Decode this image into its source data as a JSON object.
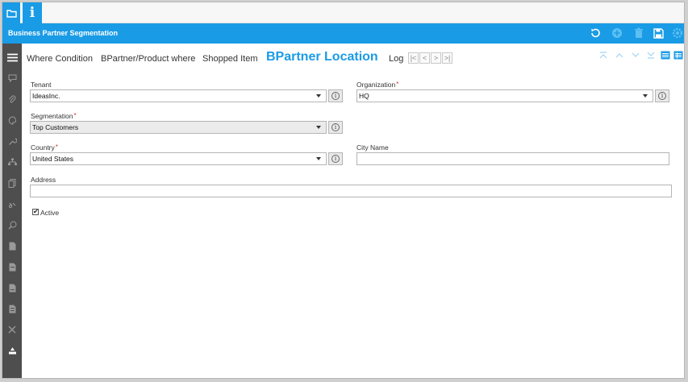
{
  "app": {
    "window_title": "Business Partner Segmentation",
    "info_tab_glyph": "i"
  },
  "colors": {
    "accent": "#1a9be6",
    "sidebar": "#4e4e4e",
    "required": "#e03030"
  },
  "toolbar": {
    "icons": [
      "refresh-icon",
      "new-record-icon",
      "delete-icon",
      "save-icon",
      "settings-icon"
    ]
  },
  "tabs": [
    {
      "label": "Where Condition"
    },
    {
      "label": "BPartner/Product where"
    },
    {
      "label": "Shopped Item"
    },
    {
      "label": "BPartner Location",
      "active": true
    },
    {
      "label": "Log"
    }
  ],
  "record_nav": [
    "|<",
    "<",
    ">",
    ">|"
  ],
  "form": {
    "tenant": {
      "label": "Tenant",
      "value": "IdeasInc."
    },
    "organization": {
      "label": "Organization",
      "value": "HQ",
      "required_mark": "*"
    },
    "segmentation": {
      "label": "Segmentation",
      "value": "Top Customers",
      "required_mark": "*"
    },
    "country": {
      "label": "Country",
      "value": "United States",
      "required_mark": "*"
    },
    "city_name": {
      "label": "City Name",
      "value": ""
    },
    "address": {
      "label": "Address",
      "value": ""
    },
    "active": {
      "label": "Active",
      "checked": true,
      "check_glyph": "✔"
    }
  }
}
